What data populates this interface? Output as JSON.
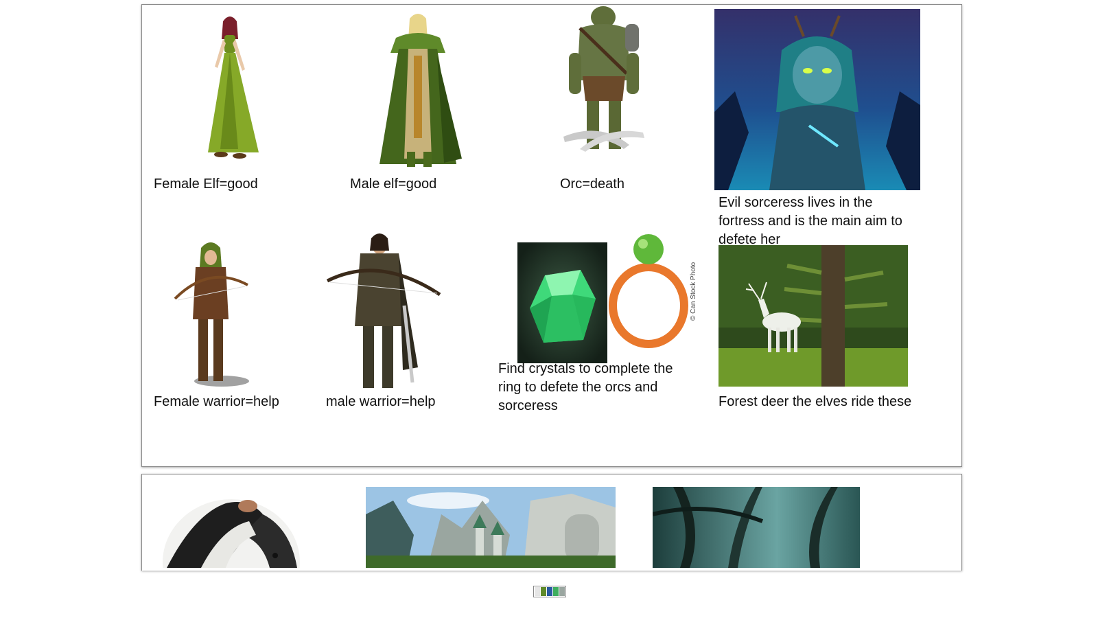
{
  "slide1": {
    "captions": {
      "female_elf": "Female Elf=good",
      "male_elf": "Male elf=good",
      "orc": "Orc=death",
      "sorceress": "Evil sorceress lives in the fortress and is the main aim to defete her",
      "female_warrior": "Female warrior=help",
      "male_warrior": "male warrior=help",
      "crystals": "Find crystals to complete the ring to defete the orcs and sorceress",
      "deer": "Forest deer the elves ride these"
    },
    "watermark": "© Can Stock Photo"
  },
  "slide2": {
    "images": [
      "badger",
      "elven-city",
      "misty-forest"
    ]
  },
  "colors": {
    "forest_green": "#4f7a22",
    "crystal_green": "#3fd97a",
    "ring_orange": "#e9782c",
    "sorceress_blue": "#1c3b78"
  }
}
